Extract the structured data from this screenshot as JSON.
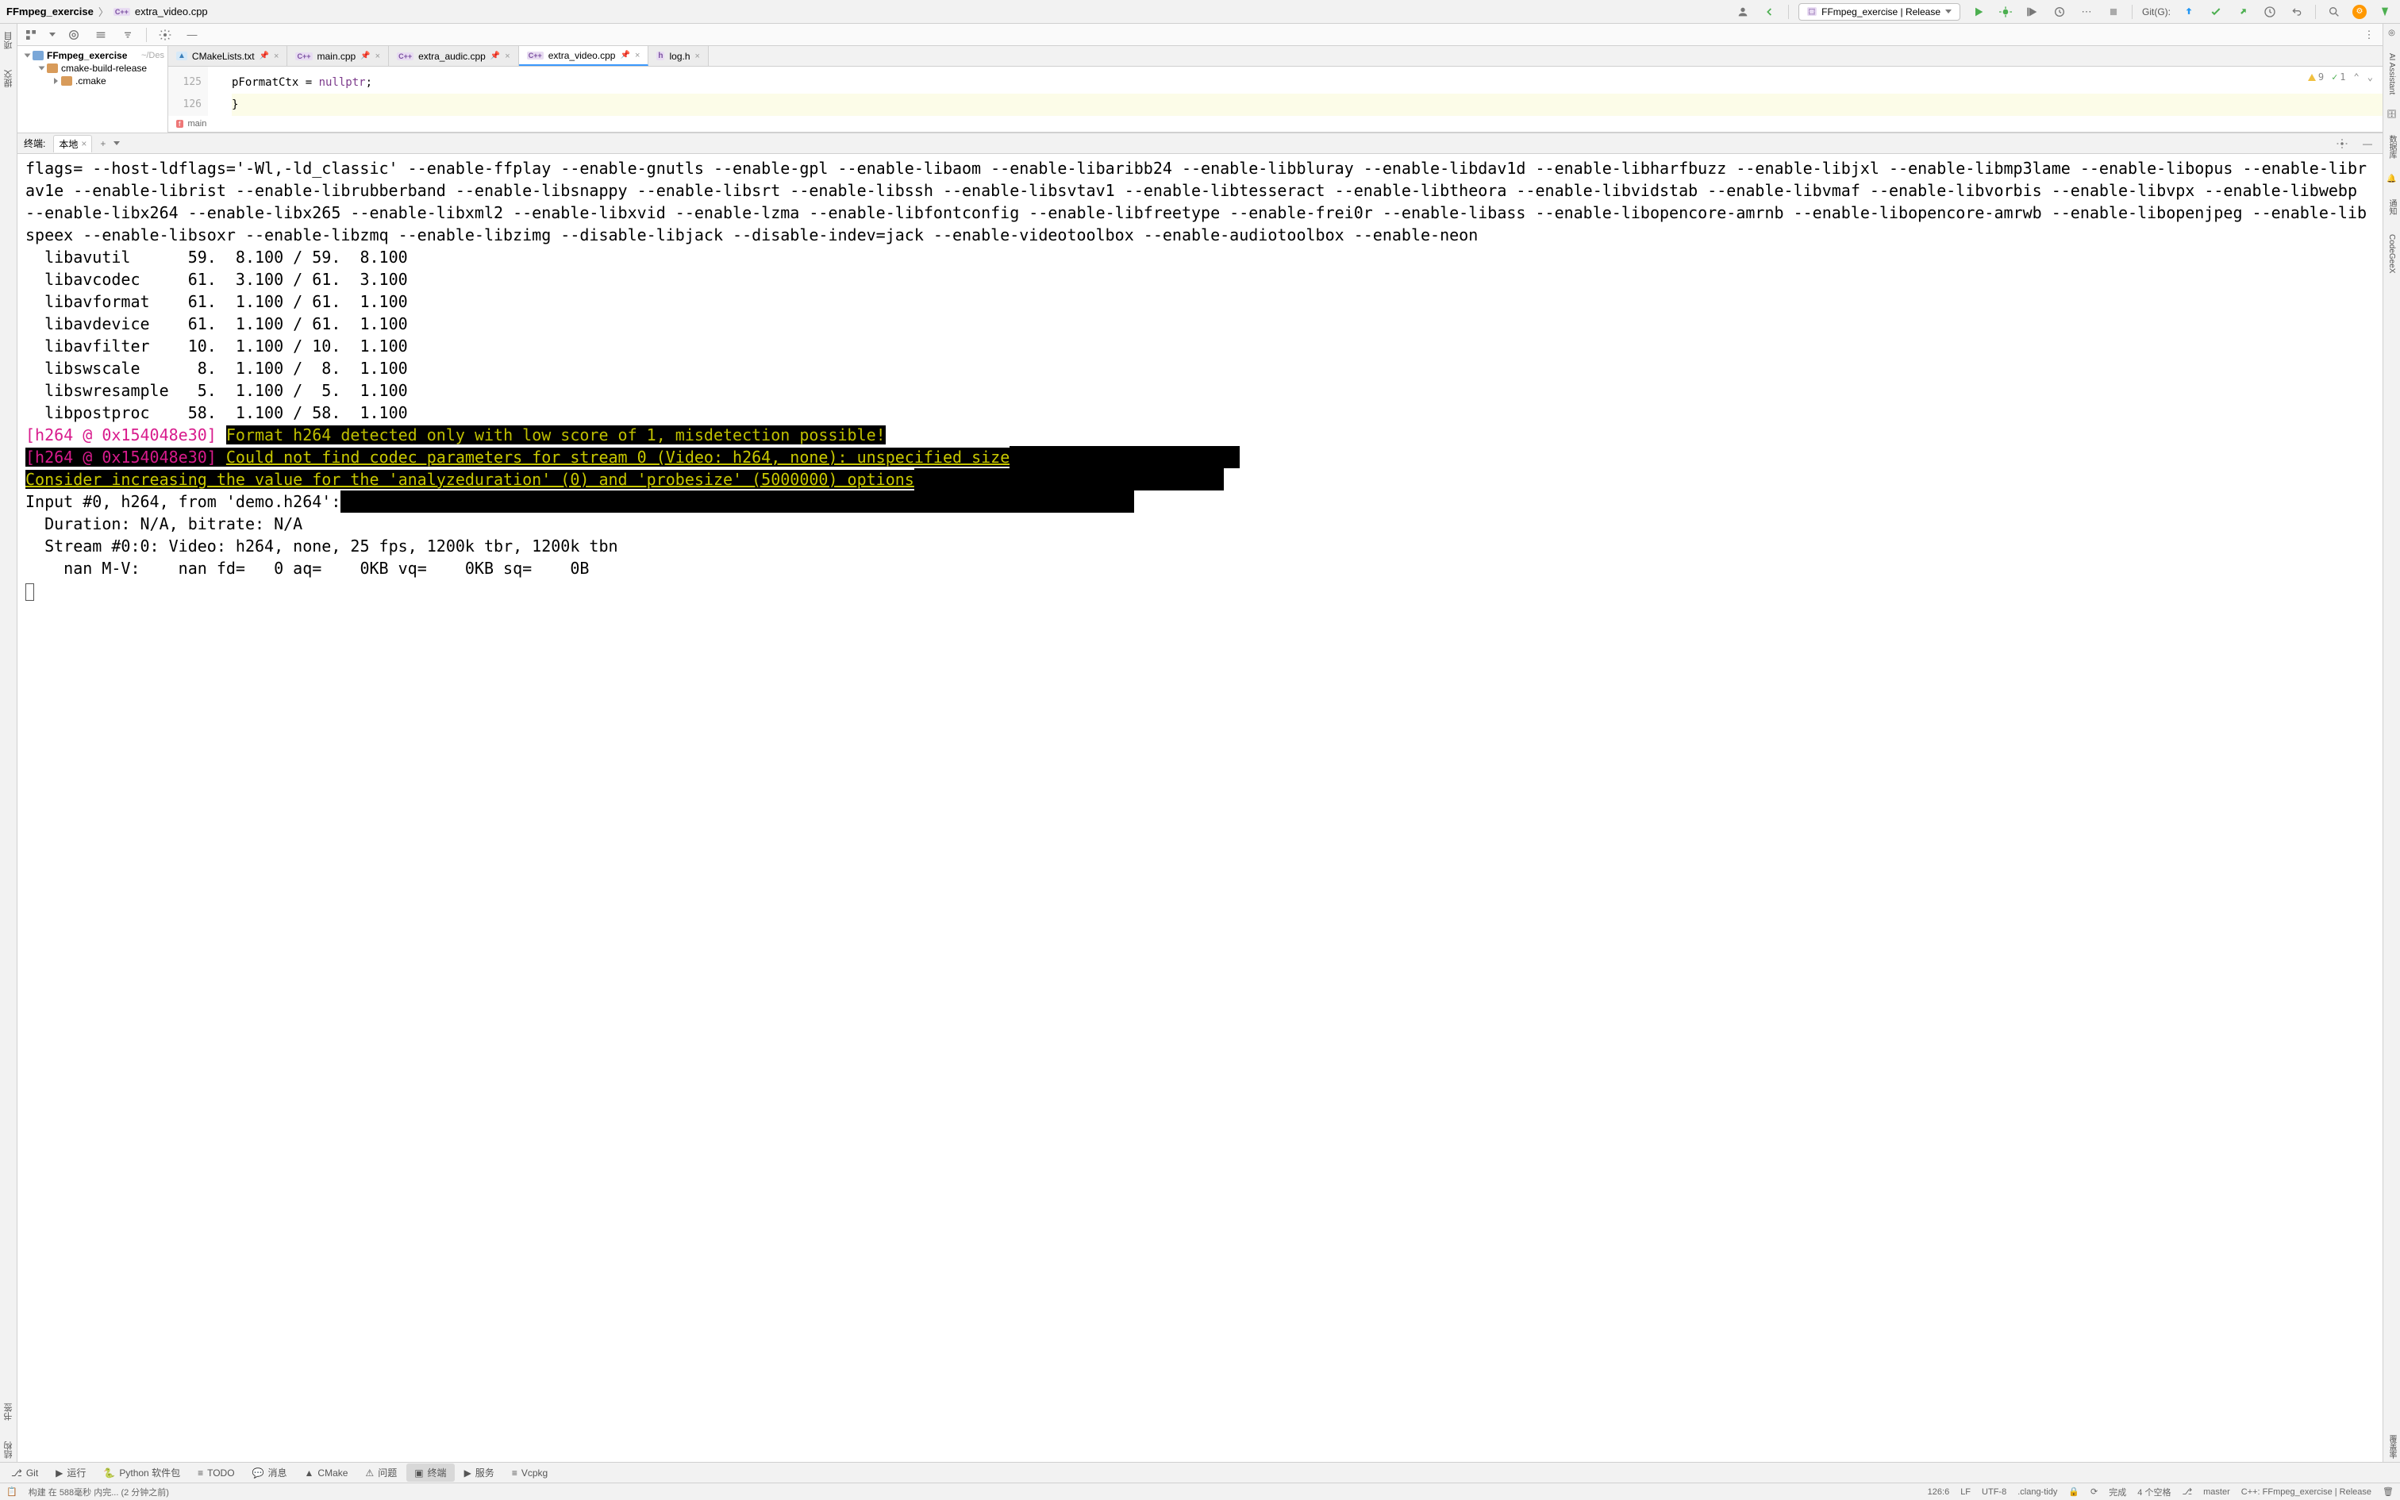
{
  "breadcrumb": {
    "project": "FFmpeg_exercise",
    "file": "extra_video.cpp",
    "file_icon": "C++"
  },
  "run_config": {
    "label": "FFmpeg_exercise | Release"
  },
  "git_label": "Git(G):",
  "project_tree": {
    "root": {
      "name": "FFmpeg_exercise",
      "tag": "~/Des"
    },
    "items": [
      {
        "name": "cmake-build-release",
        "level": 1,
        "open": true,
        "color": "orange"
      },
      {
        "name": ".cmake",
        "level": 2,
        "open": false,
        "color": "orange"
      }
    ]
  },
  "editor_tabs": [
    {
      "label": "CMakeLists.txt",
      "icon": "▲",
      "color": "cmake",
      "pinned": true,
      "active": false,
      "closable": true
    },
    {
      "label": "main.cpp",
      "icon": "C++",
      "color": "cpp",
      "pinned": true,
      "active": false,
      "closable": true
    },
    {
      "label": "extra_audic.cpp",
      "icon": "C++",
      "color": "cpp",
      "pinned": true,
      "active": false,
      "closable": true
    },
    {
      "label": "extra_video.cpp",
      "icon": "C++",
      "color": "cpp",
      "pinned": true,
      "active": true,
      "closable": true
    },
    {
      "label": "log.h",
      "icon": "h",
      "color": "h",
      "pinned": false,
      "active": false,
      "closable": true
    }
  ],
  "code": {
    "lines": [
      {
        "num": "125",
        "pre": "        pFormatCtx = ",
        "kw": "nullptr",
        "post": ";"
      },
      {
        "num": "126",
        "pre": "    }",
        "kw": "",
        "post": ""
      }
    ],
    "inspection": {
      "warn_count": "9",
      "ok_count": "1"
    },
    "crumb": "main"
  },
  "terminal_head": {
    "title": "终端:",
    "tab": "本地"
  },
  "terminal_lines": [
    {
      "t": "plain",
      "text": "flags= --host-ldflags='-Wl,-ld_classic' --enable-ffplay --enable-gnutls --enable-gpl --enable-libaom --enable-libaribb24 --enable-libbluray --enable-libdav1d --enable-libharfbuzz --enable-libjxl --enable-libmp3lame --enable-libopus --enable-librav1e --enable-librist --enable-librubberband --enable-libsnappy --enable-libsrt --enable-libssh --enable-libsvtav1 --enable-libtesseract --enable-libtheora --enable-libvidstab --enable-libvmaf --enable-libvorbis --enable-libvpx --enable-libwebp --enable-libx264 --enable-libx265 --enable-libxml2 --enable-libxvid --enable-lzma --enable-libfontconfig --enable-libfreetype --enable-frei0r --enable-libass --enable-libopencore-amrnb --enable-libopencore-amrwb --enable-libopenjpeg --enable-libspeex --enable-libsoxr --enable-libzmq --enable-libzimg --disable-libjack --disable-indev=jack --enable-videotoolbox --enable-audiotoolbox --enable-neon"
    },
    {
      "t": "plain",
      "text": "  libavutil      59.  8.100 / 59.  8.100"
    },
    {
      "t": "plain",
      "text": "  libavcodec     61.  3.100 / 61.  3.100"
    },
    {
      "t": "plain",
      "text": "  libavformat    61.  1.100 / 61.  1.100"
    },
    {
      "t": "plain",
      "text": "  libavdevice    61.  1.100 / 61.  1.100"
    },
    {
      "t": "plain",
      "text": "  libavfilter    10.  1.100 / 10.  1.100"
    },
    {
      "t": "plain",
      "text": "  libswscale      8.  1.100 /  8.  1.100"
    },
    {
      "t": "plain",
      "text": "  libswresample   5.  1.100 /  5.  1.100"
    },
    {
      "t": "plain",
      "text": "  libpostproc    58.  1.100 / 58.  1.100"
    },
    {
      "t": "warn1",
      "prefix": "[h264 @ 0x154048e30] ",
      "msg": "Format h264 detected only with low score of 1, misdetection possible!"
    },
    {
      "t": "warn2",
      "prefix": "[h264 @ 0x154048e30] ",
      "msg": "Could not find codec parameters for stream 0 (Video: h264, none): unspecified size",
      "selpad": 290
    },
    {
      "t": "warn-cont",
      "msg": "Consider increasing the value for the 'analyzeduration' (0) and 'probesize' (5000000) options",
      "selpad": 390
    },
    {
      "t": "input",
      "text": "Input #0, h264, from 'demo.h264':",
      "selpad": 1000
    },
    {
      "t": "plain",
      "text": "  Duration: N/A, bitrate: N/A"
    },
    {
      "t": "plain",
      "text": "  Stream #0:0: Video: h264, none, 25 fps, 1200k tbr, 1200k tbn"
    },
    {
      "t": "plain",
      "text": "    nan M-V:    nan fd=   0 aq=    0KB vq=    0KB sq=    0B "
    },
    {
      "t": "cursor"
    }
  ],
  "bottom_tabs": [
    {
      "label": "Git",
      "icon": "⎇"
    },
    {
      "label": "运行",
      "icon": "▶"
    },
    {
      "label": "Python 软件包",
      "icon": "🐍"
    },
    {
      "label": "TODO",
      "icon": "≡"
    },
    {
      "label": "消息",
      "icon": "💬"
    },
    {
      "label": "CMake",
      "icon": "▲"
    },
    {
      "label": "问题",
      "icon": "⚠"
    },
    {
      "label": "终端",
      "icon": "▣",
      "active": true
    },
    {
      "label": "服务",
      "icon": "▶"
    },
    {
      "label": "Vcpkg",
      "icon": "≡"
    }
  ],
  "statusbar": {
    "left": "构建 在 588毫秒 内完... (2 分钟之前)",
    "pos": "126:6",
    "lf": "LF",
    "enc": "UTF-8",
    "tidy": ".clang-tidy",
    "lock": "🔒",
    "done": "完成",
    "indent": "4 个空格",
    "branch": "master",
    "config": "C++: FFmpeg_exercise | Release"
  },
  "left_tabs": {
    "top": "项目",
    "t2": "提交",
    "b1": "书签",
    "b2": "结构"
  },
  "right_tabs": {
    "t1": "AI Assistant",
    "t2": "数据库",
    "t3": "通知",
    "t4": "CodeGeeX",
    "b1": "覆盖率"
  }
}
